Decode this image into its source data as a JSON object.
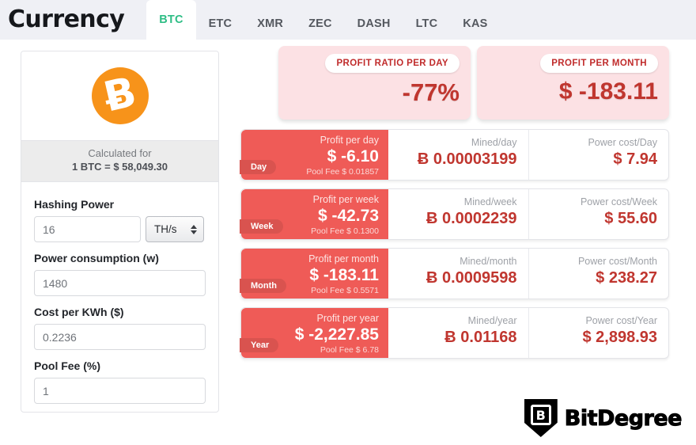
{
  "header": {
    "brand": "Currency",
    "tabs": [
      {
        "label": "BTC",
        "active": true
      },
      {
        "label": "ETC",
        "active": false
      },
      {
        "label": "XMR",
        "active": false
      },
      {
        "label": "ZEC",
        "active": false
      },
      {
        "label": "DASH",
        "active": false
      },
      {
        "label": "LTC",
        "active": false
      },
      {
        "label": "KAS",
        "active": false
      }
    ],
    "active_tab_color": "#2ebd85",
    "background": "#eff0f5"
  },
  "sidebar": {
    "coin_icon": "bitcoin-icon",
    "coin_glyph": "Ƀ",
    "coin_color": "#f7931a",
    "calculated_for_label": "Calculated for",
    "calculated_for_value": "1 BTC = $ 58,049.30",
    "fields": [
      {
        "label": "Hashing Power",
        "value": "16",
        "unit": "TH/s",
        "has_unit_select": true
      },
      {
        "label": "Power consumption (w)",
        "value": "1480",
        "has_unit_select": false
      },
      {
        "label": "Cost per KWh ($)",
        "value": "0.2236",
        "has_unit_select": false
      },
      {
        "label": "Pool Fee (%)",
        "value": "1",
        "has_unit_select": false
      }
    ]
  },
  "summary": {
    "accent_bg": "#fce1e4",
    "accent_text": "#c0362f",
    "cards": [
      {
        "title": "PROFIT RATIO PER DAY",
        "value": "-77%",
        "kind": "ratio"
      },
      {
        "title": "PROFIT PER MONTH",
        "value": "$ -183.11",
        "kind": "money"
      }
    ]
  },
  "results": {
    "row_bg": "#ef5b57",
    "badge_bg": "#d9534f",
    "value_color": "#c0362f",
    "rows": [
      {
        "badge": "Day",
        "profit_label": "Profit per day",
        "profit_value": "$ -6.10",
        "pool_fee": "Pool Fee $ 0.01857",
        "mined_label": "Mined/day",
        "mined_value": "Ƀ 0.00003199",
        "power_label": "Power cost/Day",
        "power_value": "$ 7.94"
      },
      {
        "badge": "Week",
        "profit_label": "Profit per week",
        "profit_value": "$ -42.73",
        "pool_fee": "Pool Fee $ 0.1300",
        "mined_label": "Mined/week",
        "mined_value": "Ƀ 0.0002239",
        "power_label": "Power cost/Week",
        "power_value": "$ 55.60"
      },
      {
        "badge": "Month",
        "profit_label": "Profit per month",
        "profit_value": "$ -183.11",
        "pool_fee": "Pool Fee $ 0.5571",
        "mined_label": "Mined/month",
        "mined_value": "Ƀ 0.0009598",
        "power_label": "Power cost/Month",
        "power_value": "$ 238.27"
      },
      {
        "badge": "Year",
        "profit_label": "Profit per year",
        "profit_value": "$ -2,227.85",
        "pool_fee": "Pool Fee $ 6.78",
        "mined_label": "Mined/year",
        "mined_value": "Ƀ 0.01168",
        "power_label": "Power cost/Year",
        "power_value": "$ 2,898.93"
      }
    ]
  },
  "footer": {
    "logo_mark": "B",
    "logo_text": "BitDegree"
  }
}
